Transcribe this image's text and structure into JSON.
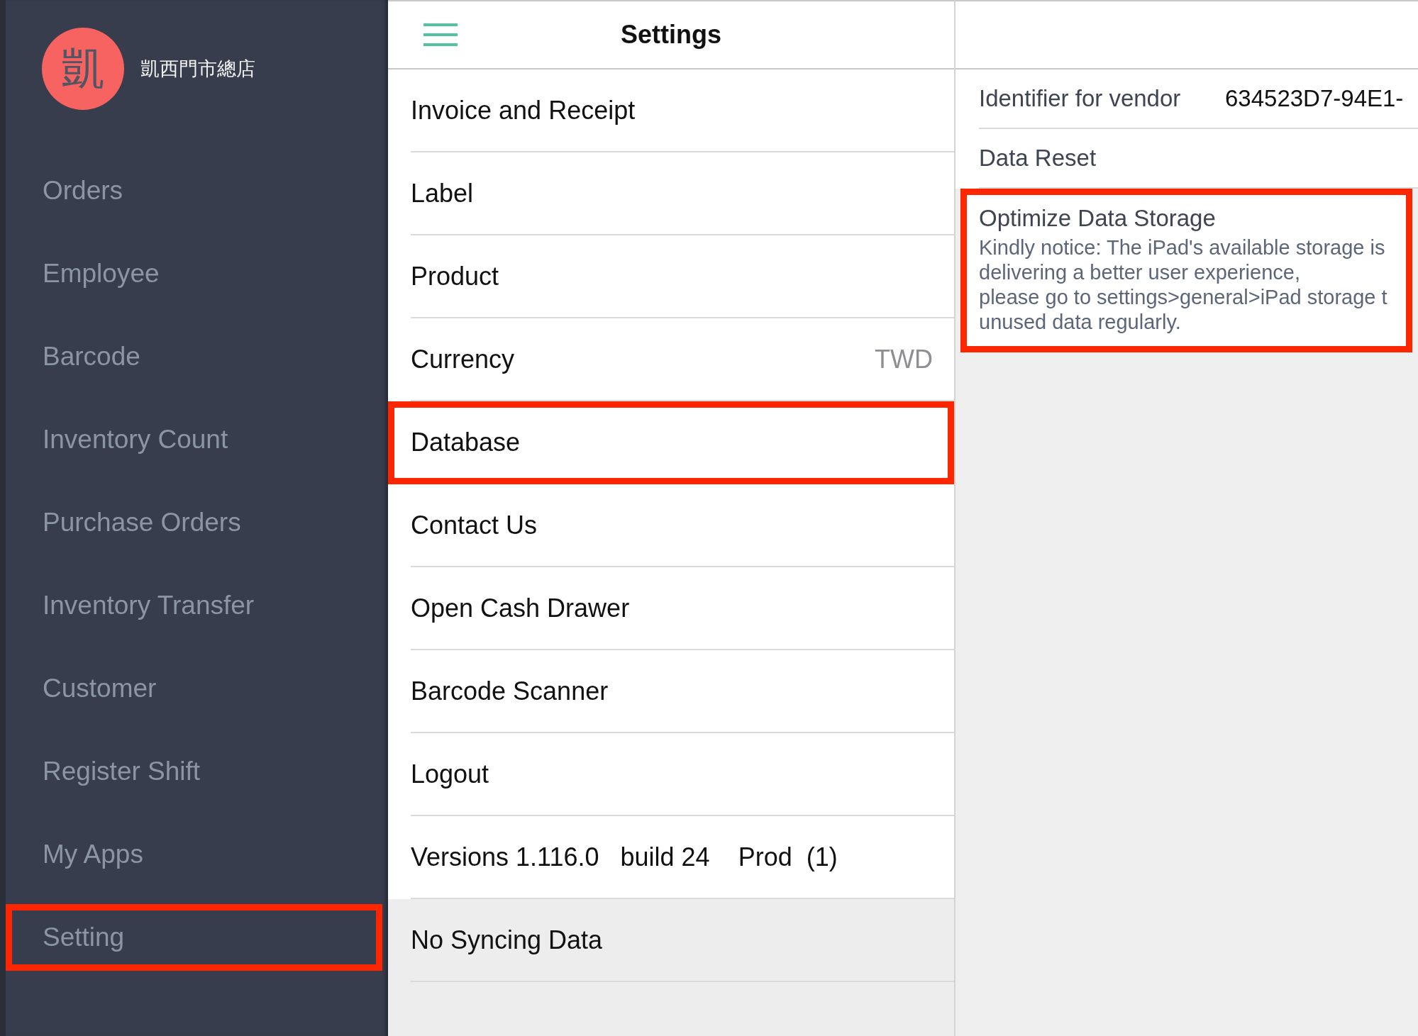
{
  "sidebar": {
    "store": {
      "logo_text": "凱",
      "name": "凱西門市總店"
    },
    "items": [
      {
        "label": "Orders",
        "highlighted": false
      },
      {
        "label": "Employee",
        "highlighted": false
      },
      {
        "label": "Barcode",
        "highlighted": false
      },
      {
        "label": "Inventory Count",
        "highlighted": false
      },
      {
        "label": "Purchase Orders",
        "highlighted": false
      },
      {
        "label": "Inventory Transfer",
        "highlighted": false
      },
      {
        "label": "Customer",
        "highlighted": false
      },
      {
        "label": "Register Shift",
        "highlighted": false
      },
      {
        "label": "My Apps",
        "highlighted": false
      },
      {
        "label": "Setting",
        "highlighted": true
      }
    ]
  },
  "settings": {
    "title": "Settings",
    "rows": [
      {
        "kind": "item",
        "label": "Invoice and Receipt",
        "highlighted": false
      },
      {
        "kind": "item",
        "label": "Label",
        "highlighted": false
      },
      {
        "kind": "item",
        "label": "Product",
        "highlighted": false
      },
      {
        "kind": "item",
        "label": "Currency",
        "value": "TWD",
        "highlighted": false
      },
      {
        "kind": "item",
        "label": "Database",
        "highlighted": true
      },
      {
        "kind": "item",
        "label": "Contact Us",
        "highlighted": false
      },
      {
        "kind": "item",
        "label": "Open Cash Drawer",
        "highlighted": false
      },
      {
        "kind": "item",
        "label": "Barcode Scanner",
        "highlighted": false
      },
      {
        "kind": "item",
        "label": "Logout",
        "highlighted": false
      },
      {
        "kind": "info",
        "label": "Versions 1.116.0   build 24    Prod  (1)",
        "highlighted": false
      },
      {
        "kind": "status",
        "label": "No Syncing Data",
        "highlighted": false
      }
    ]
  },
  "detail": {
    "rows": [
      {
        "kind": "field",
        "label": "Identifier for vendor",
        "value": "634523D7-94E1-",
        "highlighted": false
      },
      {
        "kind": "action",
        "label": "Data Reset",
        "highlighted": false
      },
      {
        "kind": "notice",
        "title": "Optimize Data Storage",
        "lines": [
          "Kindly notice: The iPad's available storage is",
          "delivering a better user experience,",
          "please go to settings>general>iPad storage t",
          "unused data regularly."
        ],
        "highlighted": true
      }
    ]
  }
}
